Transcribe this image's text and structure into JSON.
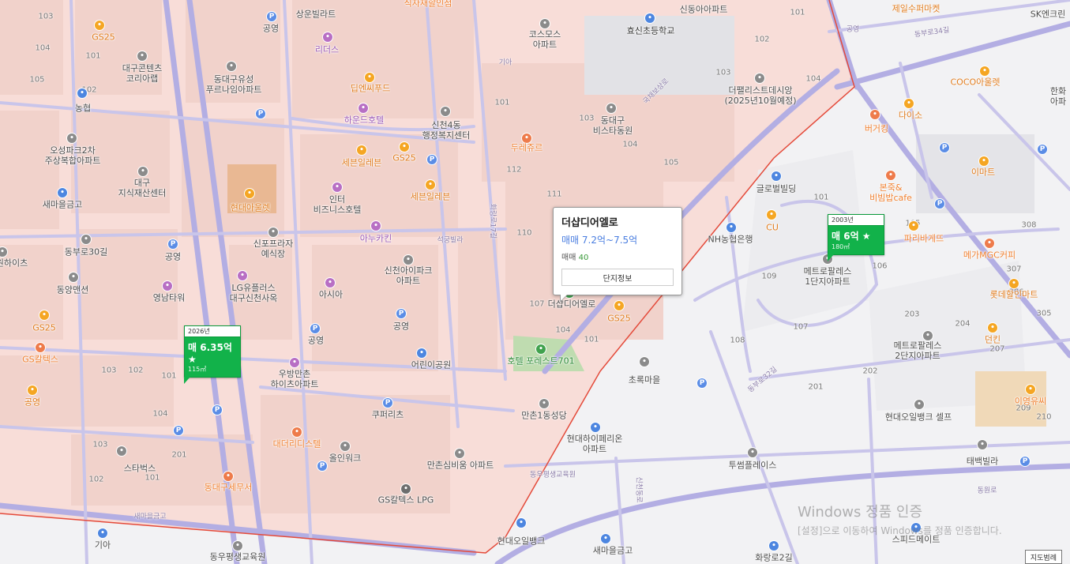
{
  "colors": {
    "zone": "#f8ddd8",
    "block": "#f1d2cb",
    "road_main": "#b3aee3",
    "road_minor": "#c9c5ea",
    "boundary": "#e44a3a",
    "marker": "#12b24a",
    "popup_price": "#4a7ee0"
  },
  "popup": {
    "name": "더샵디어엘로",
    "price": "매매 7.2억~7.5억",
    "count_label": "매매",
    "count_value": "40",
    "button_label": "단지정보"
  },
  "markers": [
    {
      "year": "2026년",
      "price": "매 6.35억 ★",
      "area": "115㎡"
    },
    {
      "year": "2003년",
      "price": "매 6억 ★",
      "area": "180㎡"
    }
  ],
  "labels": [
    "상운빌라트",
    "식자재할인점",
    "효신초등학교",
    "신동아아파트",
    "제일수퍼마켓",
    "SK엔크린",
    "GS25",
    "공영",
    "리더스",
    "코스모스\n아파트",
    "화랑로11길",
    "대구콘텐츠\n코리아랩",
    "동대구유성\n푸르나임아파트",
    "딥엔씨푸드",
    "하운드호텔",
    "더팰리스트데시앙\n(2025년10월예정)",
    "COCO아울렛",
    "한화\n아파",
    "동대구\n비스타동원",
    "다이소",
    "버거킹",
    "농협",
    "신천4동\n행정복지센터",
    "오성파크2차\n주상복합아파트",
    "두레쥬르",
    "세븐일레븐",
    "GS25",
    "이마트",
    "대구\n지식재산센터",
    "인터\n비즈니스호텔",
    "세븐일레븐",
    "글로벌빌딩",
    "본죽&\n비빔밥cafe",
    "새마을금고",
    "현대아울렛",
    "아누카킨",
    "CU",
    "파리바게뜨",
    "신포프라자\n예식장",
    "동부로30길",
    "석궁빌라",
    "NH농협은행",
    "메가MGC커피",
    "신천아이파크\n아파트",
    "메트로팔레스\n1단지아파트",
    "원하이츠",
    "공영",
    "동양맨션",
    "LG유플러스\n대구신천사옥",
    "영남타워",
    "아시아",
    "더샵디어엘로",
    "GS25",
    "롯데할인마트",
    "공영",
    "GS25",
    "공영",
    "메트로팔레스\n2단지아파트",
    "던킨",
    "GS칼텍스",
    "어린이공원",
    "호텔\n포레스트701",
    "우방만촌\n하이츠아파트",
    "초록마을",
    "이영유씨",
    "공영",
    "쿠퍼리츠",
    "만촌1동성당",
    "현대오일뱅크\n셀프",
    "현대하이페리온\n아파트",
    "스타벅스",
    "대더리디스텔",
    "올인워크",
    "만촌심비움\n아파트",
    "태백빌라",
    "투썸플레이스",
    "동대구세무서",
    "GS칼텍스\nLPG",
    "현대오일뱅크",
    "스피드메이트",
    "기아",
    "동우평생교육원",
    "새마을금고",
    "화랑로2길",
    "국채보상로",
    "동부로34길",
    "화랑로17길",
    "동부로32길",
    "동원로",
    "국채보상로",
    "공영",
    "신천동로",
    "용정로"
  ],
  "legend_button": "지도범례",
  "watermark": {
    "line1": "Windows 정품 인증",
    "line2": "[설정]으로 이동하여 Windows를 정품 인증합니다."
  }
}
